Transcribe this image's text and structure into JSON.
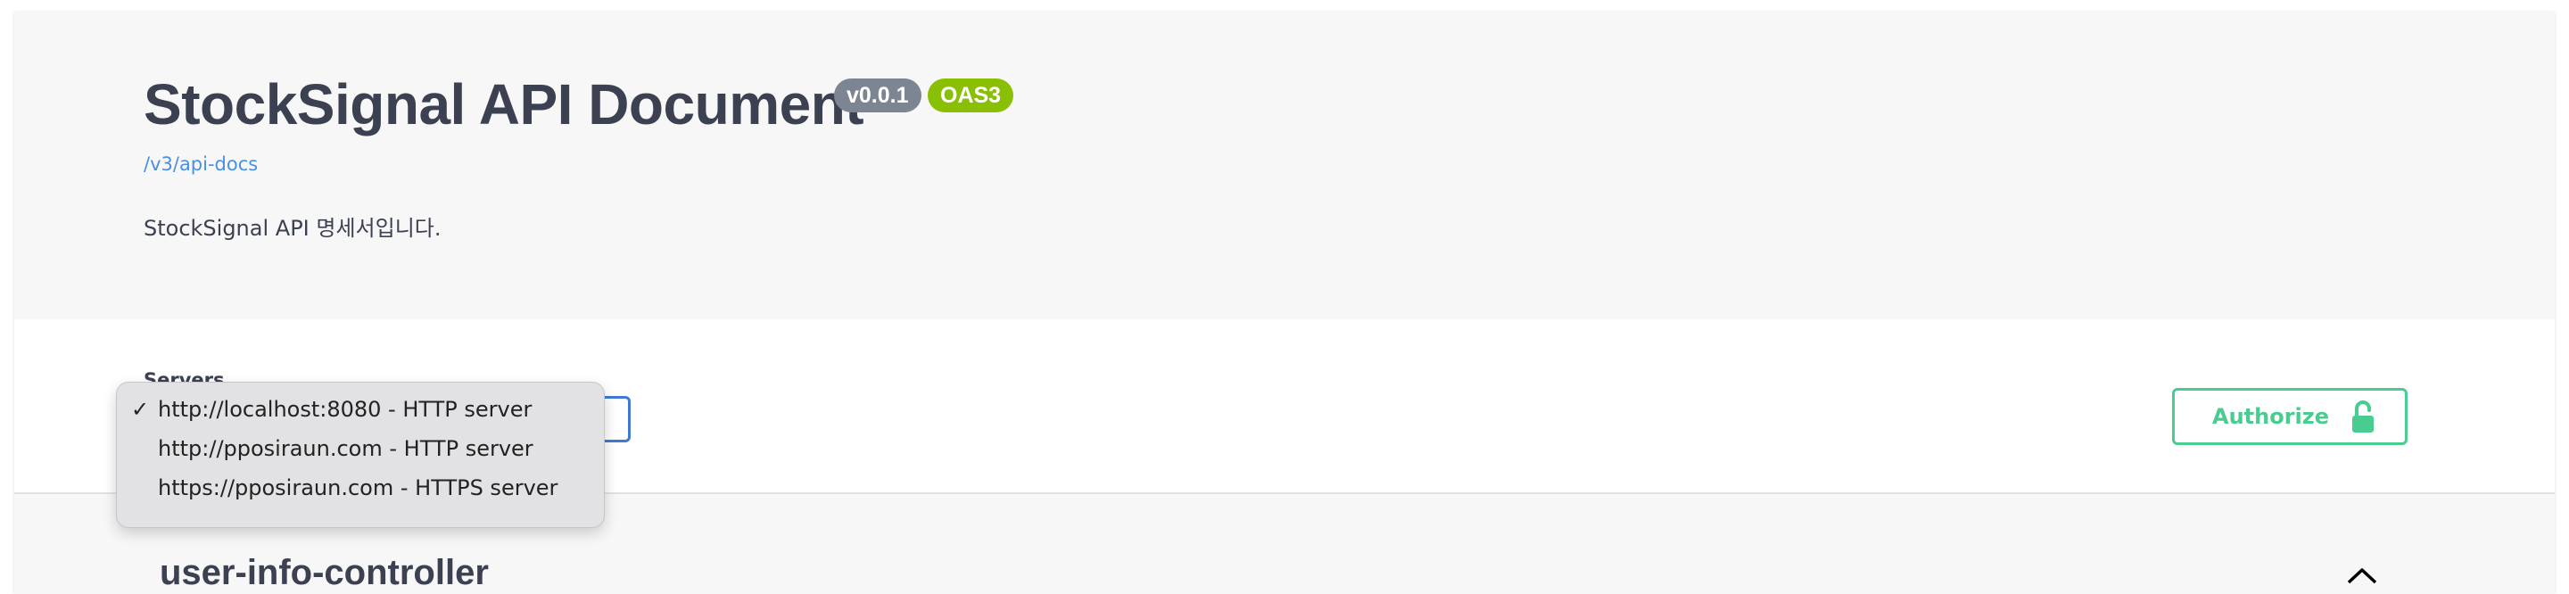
{
  "info": {
    "title": "StockSignal API Document",
    "version_badge": "v0.0.1",
    "oas_badge": "OAS3",
    "spec_link": "/v3/api-docs",
    "description": "StockSignal API 명세서입니다."
  },
  "servers": {
    "label": "Servers",
    "selected": "http://localhost:8080 - HTTP server",
    "options": [
      {
        "label": "http://localhost:8080 - HTTP server",
        "checked": true
      },
      {
        "label": "http://pposiraun.com - HTTP server",
        "checked": false
      },
      {
        "label": "https://pposiraun.com - HTTPS server",
        "checked": false
      }
    ],
    "check_glyph": "✓"
  },
  "authorize": {
    "label": "Authorize",
    "icon": "unlocked-lock-icon"
  },
  "controllers": [
    {
      "name": "user-info-controller",
      "icon": "chevron-up-icon",
      "expanded": true
    }
  ],
  "colors": {
    "authorize_green": "#49cc90",
    "oas_badge": "#89bf04",
    "version_badge": "#7d8492",
    "link_blue": "#4990e2",
    "select_border": "#4178d4"
  }
}
